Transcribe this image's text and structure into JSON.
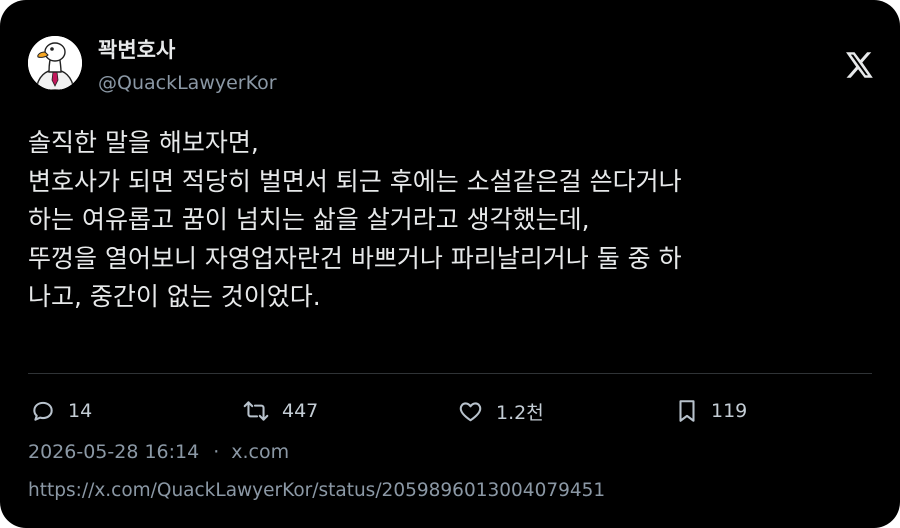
{
  "author": {
    "display_name": "꽉변호사",
    "handle": "@QuackLawyerKor",
    "avatar_icon": "goose-avatar-icon"
  },
  "platform_icon": "x-logo-icon",
  "post": {
    "lines": [
      "솔직한 말을 해보자면,",
      "변호사가 되면 적당히 벌면서 퇴근 후에는 소설같은걸 쓴다거나",
      "하는 여유롭고 꿈이 넘치는 삶을 살거라고 생각했는데,",
      "뚜껑을 열어보니 자영업자란건 바쁘거나 파리날리거나 둘 중 하",
      "나고, 중간이 없는 것이었다."
    ]
  },
  "actions": {
    "replies": "14",
    "reposts": "447",
    "likes": "1.2천",
    "bookmarks": "119"
  },
  "meta": {
    "timestamp": "2026-05-28 16:14",
    "separator": "·",
    "source": "x.com"
  },
  "status_url": "https://x.com/QuackLawyerKor/status/2059896013004079451",
  "colors": {
    "background": "#000000",
    "text_primary": "#e7e9ea",
    "text_secondary": "#8b98a5",
    "divider": "#2f3336"
  }
}
